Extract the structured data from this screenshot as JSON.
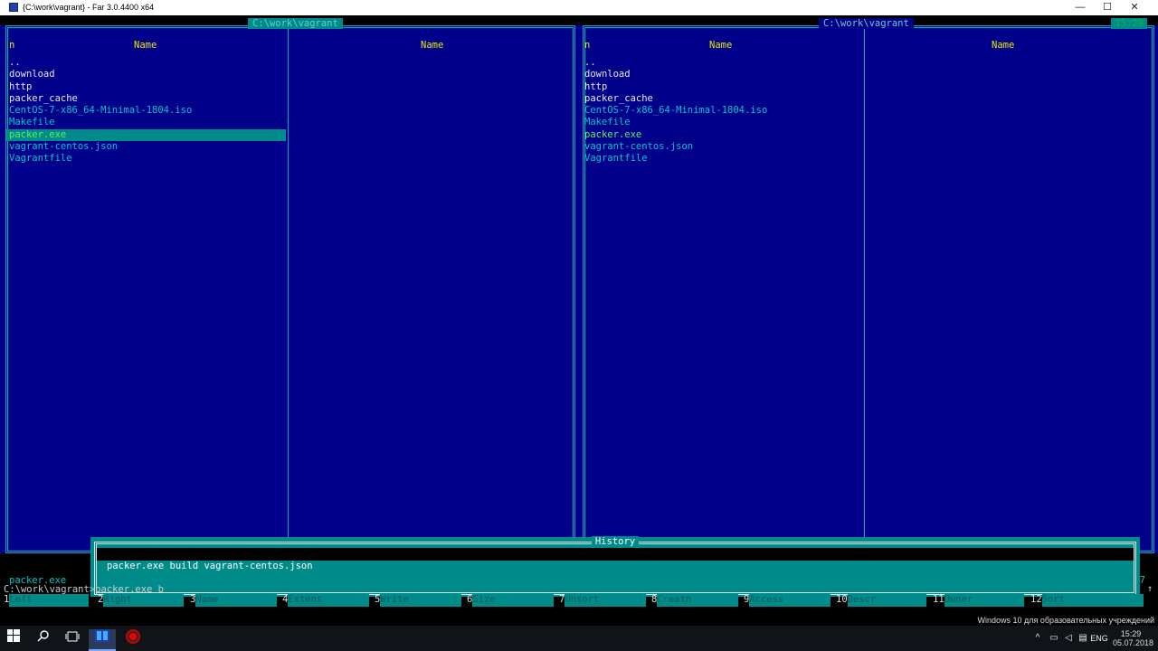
{
  "window": {
    "title": "{C:\\work\\vagrant} - Far 3.0.4400 x64",
    "minimize": "—",
    "maximize": "☐",
    "close": "✕"
  },
  "left_panel": {
    "path": " C:\\work\\vagrant ",
    "col1_n": "n",
    "col1_name": "Name",
    "col2_name": "Name",
    "files": [
      {
        "name": "..",
        "type": "dir"
      },
      {
        "name": "download",
        "type": "dir"
      },
      {
        "name": "http",
        "type": "dir"
      },
      {
        "name": "packer_cache",
        "type": "dir"
      },
      {
        "name": "CentOS-7-x86_64-Minimal-1804.iso",
        "type": "file"
      },
      {
        "name": "Makefile",
        "type": "file"
      },
      {
        "name": "packer.exe",
        "type": "exe",
        "cursor": true
      },
      {
        "name": "vagrant-centos.json",
        "type": "file"
      },
      {
        "name": "Vagrantfile",
        "type": "file"
      }
    ],
    "status": "packer.exe"
  },
  "right_panel": {
    "path": " C:\\work\\vagrant ",
    "clock": "15:29",
    "col1_n": "n",
    "col1_name": "Name",
    "col2_name": "Name",
    "files": [
      {
        "name": "..",
        "type": "dir"
      },
      {
        "name": "download",
        "type": "dir"
      },
      {
        "name": "http",
        "type": "dir"
      },
      {
        "name": "packer_cache",
        "type": "dir"
      },
      {
        "name": "CentOS-7-x86_64-Minimal-1804.iso",
        "type": "file"
      },
      {
        "name": "Makefile",
        "type": "file"
      },
      {
        "name": "packer.exe",
        "type": "exe"
      },
      {
        "name": "vagrant-centos.json",
        "type": "file"
      },
      {
        "name": "Vagrantfile",
        "type": "file"
      }
    ],
    "status_right": "7"
  },
  "history": {
    "title": "History",
    "items": [
      "packer.exe build vagrant-centos.json"
    ]
  },
  "command_line": "C:\\work\\vagrant>packer.exe b_",
  "fkeys": [
    {
      "num": "1",
      "label": "Left"
    },
    {
      "num": "2",
      "label": "Right"
    },
    {
      "num": "3",
      "label": "Name"
    },
    {
      "num": "4",
      "label": "Extens"
    },
    {
      "num": "5",
      "label": "Write"
    },
    {
      "num": "6",
      "label": "Size"
    },
    {
      "num": "7",
      "label": "Unsort"
    },
    {
      "num": "8",
      "label": "Creatn"
    },
    {
      "num": "9",
      "label": "Access"
    },
    {
      "num": "10",
      "label": "Descr"
    },
    {
      "num": "11",
      "label": "Owner"
    },
    {
      "num": "12",
      "label": "Sort"
    }
  ],
  "scroll_indicator": "↑",
  "watermark": "Windows 10 для образовательных учреждений",
  "taskbar": {
    "lang": "ENG",
    "time": "15:29",
    "date": "05.07.2018",
    "tray_chevron": "^"
  }
}
